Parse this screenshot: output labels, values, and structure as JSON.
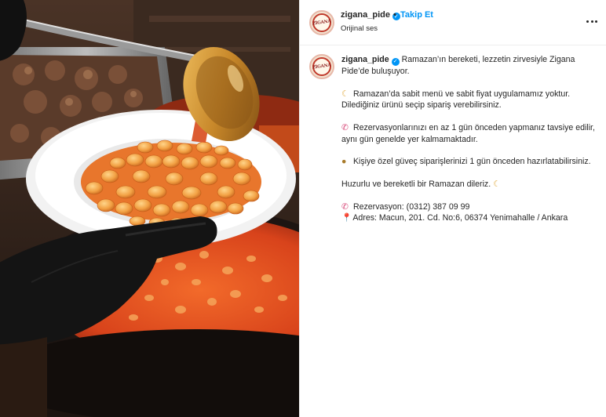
{
  "post": {
    "author": {
      "username": "zigana_pide",
      "logo_text": "ZİGANA",
      "verified_icon": "verified-badge-icon",
      "audio_label": "Orijinal ses"
    },
    "header": {
      "separator": "•",
      "follow_label": "Takip Et",
      "more_icon": "more-options-icon"
    },
    "media": {
      "description_icon": "food-photo"
    },
    "caption": {
      "intro": "Ramazan’ın bereketi, lezzetin zirvesiyle Zigana Pide’de buluşuyor.",
      "lines": [
        {
          "emoji": "☾",
          "emoji_name": "crescent-moon-icon",
          "text": "Ramazan’da sabit menü ve sabit fiyat uygulamamız yoktur. Dilediğiniz ürünü seçip sipariş verebilirsiniz."
        },
        {
          "emoji": "✆",
          "emoji_name": "phone-icon",
          "text": "Rezervasyonlarınızı en az 1 gün önceden yapmanız tavsiye edilir, aynı gün genelde yer kalmamaktadır."
        },
        {
          "emoji": "●",
          "emoji_name": "clay-pot-icon",
          "text": "Kişiye özel güveç siparişlerinizi 1 gün önceden hazırlatabilirsiniz."
        }
      ],
      "closing": "Huzurlu ve bereketli bir Ramazan dileriz.",
      "closing_emoji": "☾",
      "reservation_emoji": "✆",
      "reservation": "Rezervasyon: (0312) 387 09 99",
      "address_emoji": "📍",
      "address": "Adres: Macun, 201. Cd. No:6, 06374 Yenimahalle / Ankara"
    }
  },
  "colors": {
    "verified": "#0095f6",
    "follow": "#0095f6",
    "text": "#262626",
    "border": "#efefef"
  }
}
